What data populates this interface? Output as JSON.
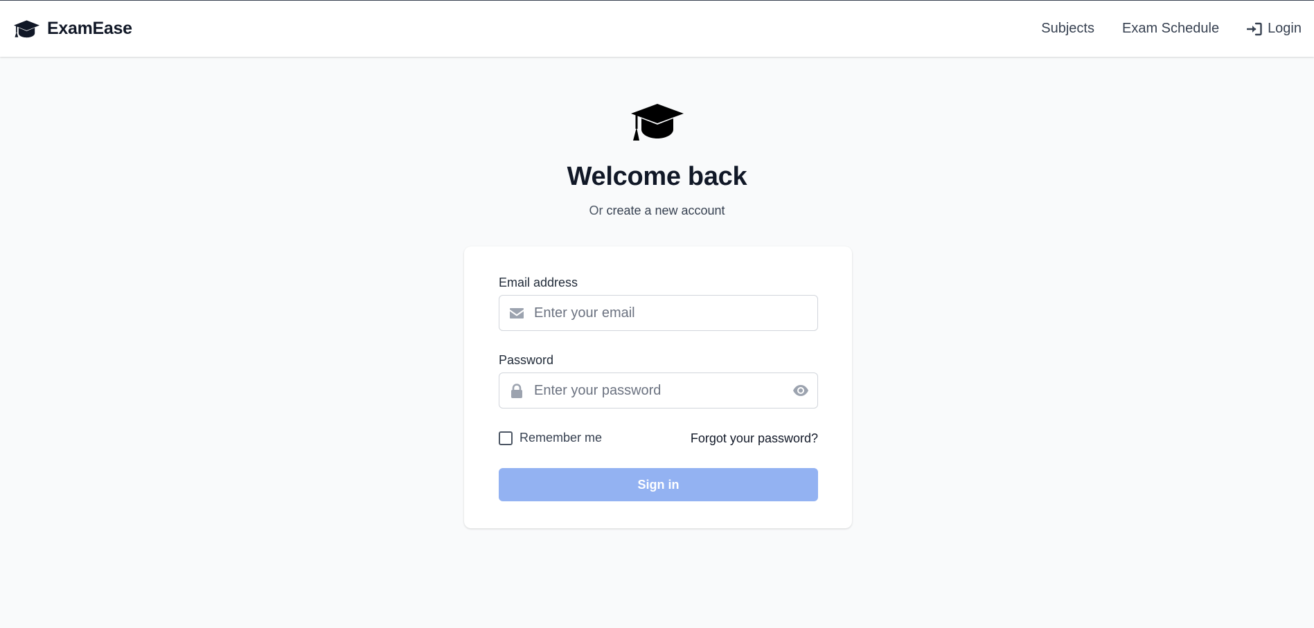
{
  "nav": {
    "brand": "ExamEase",
    "brand_icon": "graduation-cap-icon",
    "links": [
      {
        "label": "Subjects"
      },
      {
        "label": "Exam Schedule"
      },
      {
        "label": "Login",
        "icon": "sign-in-icon"
      }
    ]
  },
  "hero": {
    "icon": "graduation-cap-icon",
    "title": "Welcome back",
    "subtitle_prefix": "Or",
    "subtitle_link": "create a new account"
  },
  "form": {
    "email": {
      "label": "Email address",
      "placeholder": "Enter your email",
      "value": "",
      "icon": "envelope-icon"
    },
    "password": {
      "label": "Password",
      "placeholder": "Enter your password",
      "value": "",
      "icon": "lock-icon",
      "toggle_icon": "eye-icon"
    },
    "remember_label": "Remember me",
    "remember_checked": false,
    "forgot_label": "Forgot your password?",
    "submit_label": "Sign in"
  },
  "colors": {
    "primary_disabled": "#93b2f2",
    "text_dark": "#111827",
    "background": "#f9fafb"
  }
}
